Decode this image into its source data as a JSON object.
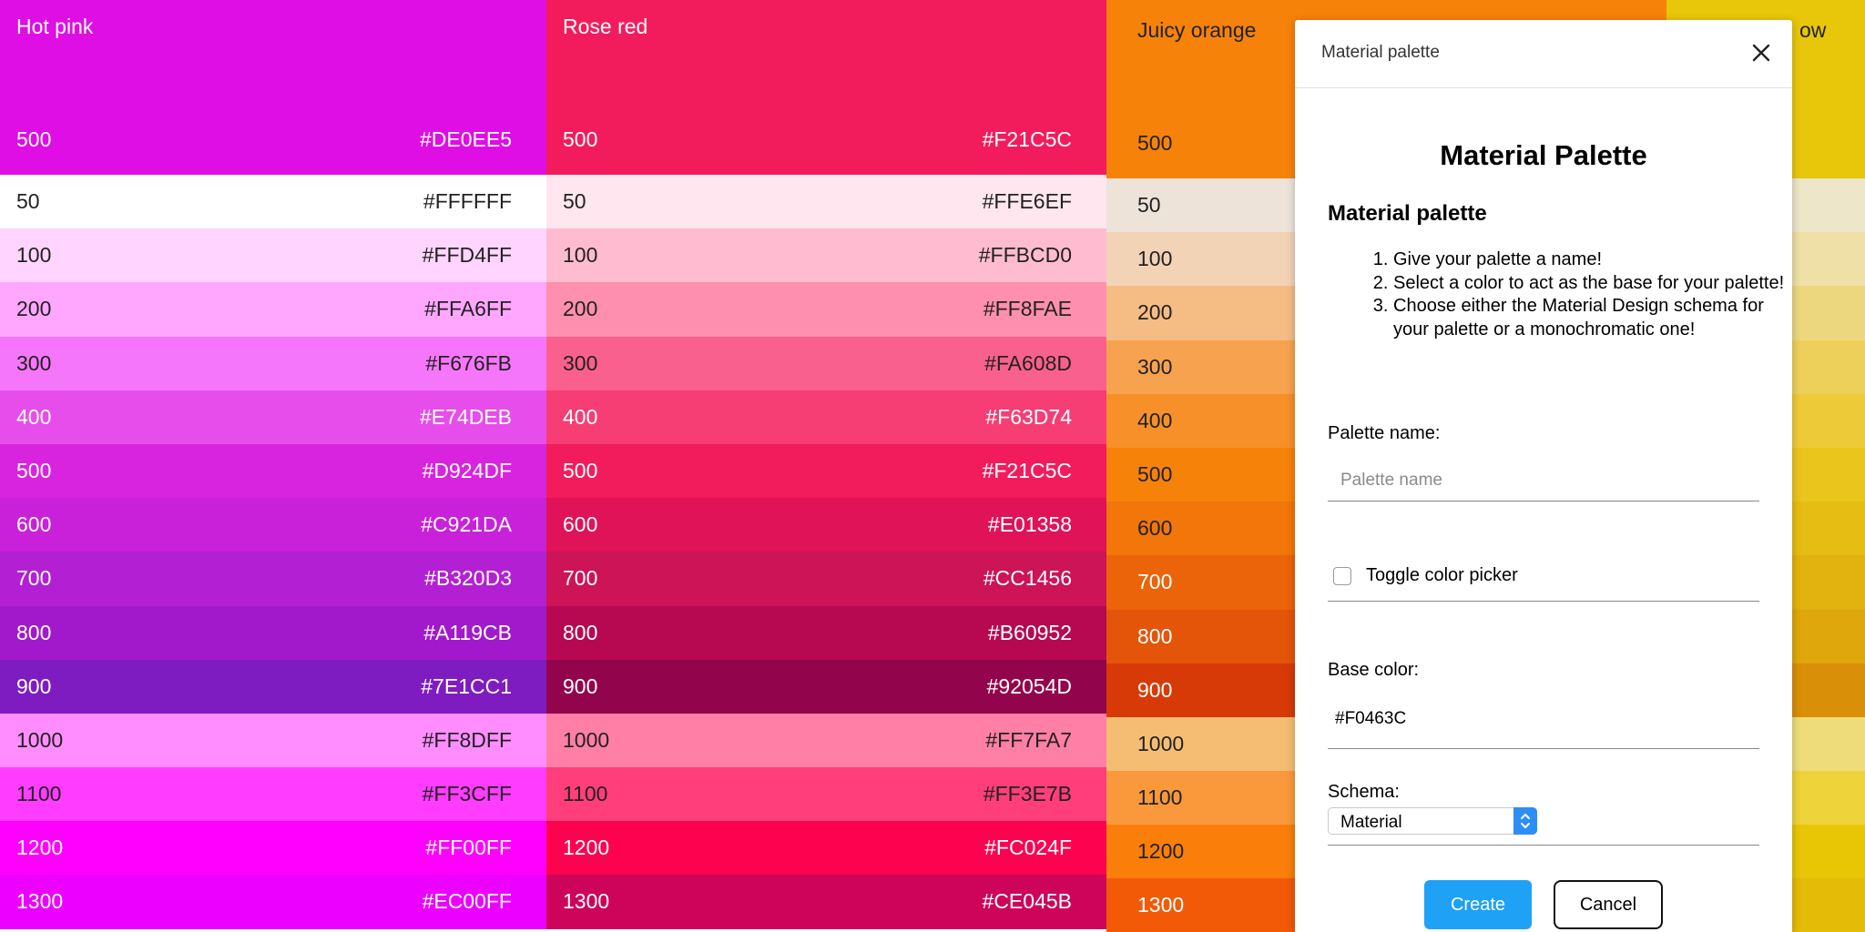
{
  "columns": [
    {
      "name": "Hot pink",
      "header_weight": "500",
      "header_hex": "#DE0EE5",
      "header_color": "#DE0EE5",
      "text_dark": "#222222",
      "rows": [
        {
          "weight": "50",
          "hex": "#FFFFFF",
          "color": "#FFFFFF",
          "text": "#222222"
        },
        {
          "weight": "100",
          "hex": "#FFD4FF",
          "color": "#FFD4FF",
          "text": "#222222"
        },
        {
          "weight": "200",
          "hex": "#FFA6FF",
          "color": "#FFA6FF",
          "text": "#222222"
        },
        {
          "weight": "300",
          "hex": "#F676FB",
          "color": "#F676FB",
          "text": "#222222"
        },
        {
          "weight": "400",
          "hex": "#E74DEB",
          "color": "#E74DEB",
          "text": "#ffffff"
        },
        {
          "weight": "500",
          "hex": "#D924DF",
          "color": "#D924DF",
          "text": "#ffffff"
        },
        {
          "weight": "600",
          "hex": "#C921DA",
          "color": "#C921DA",
          "text": "#ffffff"
        },
        {
          "weight": "700",
          "hex": "#B320D3",
          "color": "#B320D3",
          "text": "#ffffff"
        },
        {
          "weight": "800",
          "hex": "#A119CB",
          "color": "#A119CB",
          "text": "#ffffff"
        },
        {
          "weight": "900",
          "hex": "#7E1CC1",
          "color": "#7E1CC1",
          "text": "#ffffff"
        },
        {
          "weight": "1000",
          "hex": "#FF8DFF",
          "color": "#FF8DFF",
          "text": "#222222"
        },
        {
          "weight": "1100",
          "hex": "#FF3CFF",
          "color": "#FF3CFF",
          "text": "#222222"
        },
        {
          "weight": "1200",
          "hex": "#FF00FF",
          "color": "#FF00FF",
          "text": "#ffffff"
        },
        {
          "weight": "1300",
          "hex": "#EC00FF",
          "color": "#EC00FF",
          "text": "#ffffff"
        }
      ]
    },
    {
      "name": "Rose red",
      "header_weight": "500",
      "header_hex": "#F21C5C",
      "header_color": "#F21C5C",
      "rows": [
        {
          "weight": "50",
          "hex": "#FFE6EF",
          "color": "#FFE6EF",
          "text": "#222222"
        },
        {
          "weight": "100",
          "hex": "#FFBCD0",
          "color": "#FFBCD0",
          "text": "#222222"
        },
        {
          "weight": "200",
          "hex": "#FF8FAE",
          "color": "#FF8FAE",
          "text": "#222222"
        },
        {
          "weight": "300",
          "hex": "#FA608D",
          "color": "#FA608D",
          "text": "#222222"
        },
        {
          "weight": "400",
          "hex": "#F63D74",
          "color": "#F63D74",
          "text": "#ffffff"
        },
        {
          "weight": "500",
          "hex": "#F21C5C",
          "color": "#F21C5C",
          "text": "#ffffff"
        },
        {
          "weight": "600",
          "hex": "#E01358",
          "color": "#E01358",
          "text": "#ffffff"
        },
        {
          "weight": "700",
          "hex": "#CC1456",
          "color": "#CC1456",
          "text": "#ffffff"
        },
        {
          "weight": "800",
          "hex": "#B60952",
          "color": "#B60952",
          "text": "#ffffff"
        },
        {
          "weight": "900",
          "hex": "#92054D",
          "color": "#92054D",
          "text": "#ffffff"
        },
        {
          "weight": "1000",
          "hex": "#FF7FA7",
          "color": "#FF7FA7",
          "text": "#222222"
        },
        {
          "weight": "1100",
          "hex": "#FF3E7B",
          "color": "#FF3E7B",
          "text": "#222222"
        },
        {
          "weight": "1200",
          "hex": "#FC024F",
          "color": "#FC024F",
          "text": "#ffffff"
        },
        {
          "weight": "1300",
          "hex": "#CE045B",
          "color": "#CE045B",
          "text": "#ffffff"
        }
      ]
    },
    {
      "name": "Juicy orange",
      "header_weight": "500",
      "header_hex": "",
      "header_color": "#F7820A",
      "rows": [
        {
          "weight": "50",
          "hex": "",
          "color": "#EDE3D9",
          "text": "#222222"
        },
        {
          "weight": "100",
          "hex": "",
          "color": "#F2D3B6",
          "text": "#222222"
        },
        {
          "weight": "200",
          "hex": "",
          "color": "#F5BC84",
          "text": "#222222"
        },
        {
          "weight": "300",
          "hex": "",
          "color": "#F7A24E",
          "text": "#222222"
        },
        {
          "weight": "400",
          "hex": "",
          "color": "#F79029",
          "text": "#222222"
        },
        {
          "weight": "500",
          "hex": "",
          "color": "#F7820A",
          "text": "#222222"
        },
        {
          "weight": "600",
          "hex": "",
          "color": "#F27609",
          "text": "#222222"
        },
        {
          "weight": "700",
          "hex": "",
          "color": "#EB6409",
          "text": "#ffffff"
        },
        {
          "weight": "800",
          "hex": "",
          "color": "#E45409",
          "text": "#ffffff"
        },
        {
          "weight": "900",
          "hex": "",
          "color": "#D83A07",
          "text": "#ffffff"
        },
        {
          "weight": "1000",
          "hex": "",
          "color": "#F5BD74",
          "text": "#222222"
        },
        {
          "weight": "1100",
          "hex": "",
          "color": "#F9993B",
          "text": "#222222"
        },
        {
          "weight": "1200",
          "hex": "",
          "color": "#FA7E0A",
          "text": "#222222"
        },
        {
          "weight": "1300",
          "hex": "",
          "color": "#F25A08",
          "text": "#ffffff"
        }
      ]
    },
    {
      "name": "ow",
      "header_weight": "",
      "header_hex": "",
      "header_color": "#E8C60A",
      "rows": [
        {
          "weight": "",
          "hex": "",
          "color": "#EEE6C8",
          "text": "#222222"
        },
        {
          "weight": "",
          "hex": "",
          "color": "#EEE0A6",
          "text": "#222222"
        },
        {
          "weight": "",
          "hex": "",
          "color": "#EDD77E",
          "text": "#222222"
        },
        {
          "weight": "",
          "hex": "",
          "color": "#EDD05A",
          "text": "#222222"
        },
        {
          "weight": "",
          "hex": "",
          "color": "#EDCB38",
          "text": "#222222"
        },
        {
          "weight": "",
          "hex": "",
          "color": "#EAC51C",
          "text": "#222222"
        },
        {
          "weight": "",
          "hex": "",
          "color": "#E6BD12",
          "text": "#222222"
        },
        {
          "weight": "",
          "hex": "",
          "color": "#E2B20E",
          "text": "#222222"
        },
        {
          "weight": "",
          "hex": "",
          "color": "#DFA70B",
          "text": "#222222"
        },
        {
          "weight": "",
          "hex": "",
          "color": "#D98F08",
          "text": "#222222"
        },
        {
          "weight": "",
          "hex": "",
          "color": "#EEDC7A",
          "text": "#222222"
        },
        {
          "weight": "",
          "hex": "",
          "color": "#EED43A",
          "text": "#222222"
        },
        {
          "weight": "",
          "hex": "",
          "color": "#E8C606",
          "text": "#222222"
        },
        {
          "weight": "",
          "hex": "",
          "color": "#E4BB06",
          "text": "#222222"
        }
      ]
    }
  ],
  "dialog": {
    "window_title": "Material palette",
    "close_icon": "close-icon",
    "heading": "Material Palette",
    "subheading": "Material palette",
    "steps": [
      "Give your palette a name!",
      "Select a color to act as the base for your palette!",
      "Choose either the Material Design schema for your palette or a monochromatic one!"
    ],
    "palette_name_label": "Palette name:",
    "palette_name_placeholder": "Palette name",
    "palette_name_value": "",
    "toggle_label": "Toggle color picker",
    "toggle_checked": false,
    "base_color_label": "Base color:",
    "base_color_value": "#F0463C",
    "schema_label": "Schema:",
    "schema_value": "Material",
    "create_label": "Create",
    "cancel_label": "Cancel",
    "accent_color": "#1FA1F5"
  }
}
